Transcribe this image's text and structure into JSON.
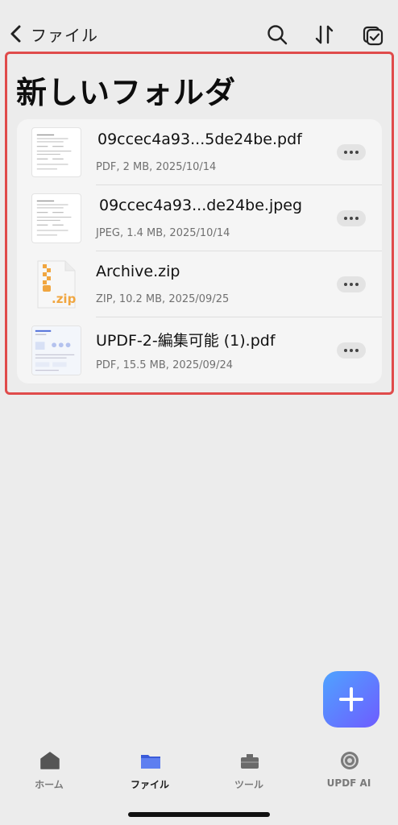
{
  "nav": {
    "back_label": "ファイル"
  },
  "folder": {
    "title": "新しいフォルダ"
  },
  "files": [
    {
      "name": "09ccec4a93...5de24be.pdf",
      "meta": "PDF, 2 MB, 2025/10/14",
      "type": "pdf"
    },
    {
      "name": "09ccec4a93...de24be.jpeg",
      "meta": "JPEG, 1.4 MB, 2025/10/14",
      "type": "jpeg"
    },
    {
      "name": "Archive.zip",
      "meta": "ZIP, 10.2 MB, 2025/09/25",
      "type": "zip",
      "thumb_label": ".zip"
    },
    {
      "name": "UPDF-2-編集可能 (1).pdf",
      "meta": "PDF, 15.5 MB, 2025/09/24",
      "type": "pdf"
    }
  ],
  "tabs": [
    {
      "label": "ホーム",
      "icon": "home-icon",
      "active": false
    },
    {
      "label": "ファイル",
      "icon": "folder-icon",
      "active": true
    },
    {
      "label": "ツール",
      "icon": "toolbox-icon",
      "active": false
    },
    {
      "label": "UPDF AI",
      "icon": "ai-icon",
      "active": false
    }
  ],
  "colors": {
    "highlight_border": "#e04b4b",
    "fab_gradient_start": "#4fa3ff",
    "fab_gradient_end": "#6e5cff",
    "zip_accent": "#f0a640"
  }
}
